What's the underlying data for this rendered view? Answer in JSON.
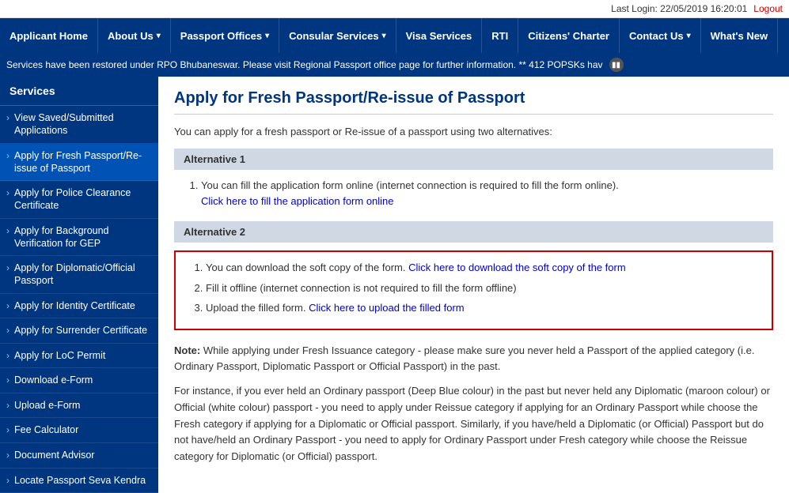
{
  "topbar": {
    "last_login_label": "Last Login: 22/05/2019 16:20:01",
    "logout_label": "Logout"
  },
  "nav": {
    "items": [
      {
        "label": "Applicant Home",
        "has_arrow": false
      },
      {
        "label": "About Us",
        "has_arrow": true
      },
      {
        "label": "Passport Offices",
        "has_arrow": true
      },
      {
        "label": "Consular Services",
        "has_arrow": true
      },
      {
        "label": "Visa Services",
        "has_arrow": false
      },
      {
        "label": "RTI",
        "has_arrow": false
      },
      {
        "label": "Citizens' Charter",
        "has_arrow": false
      },
      {
        "label": "Contact Us",
        "has_arrow": true
      },
      {
        "label": "What's New",
        "has_arrow": false
      }
    ]
  },
  "ticker": {
    "text": "Services have been restored under RPO Bhubaneswar. Please visit Regional Passport office page for further information. ** 412 POPSKs hav"
  },
  "sidebar": {
    "title": "Services",
    "items": [
      {
        "label": "View Saved/Submitted Applications"
      },
      {
        "label": "Apply for Fresh Passport/Re-issue of Passport"
      },
      {
        "label": "Apply for Police Clearance Certificate"
      },
      {
        "label": "Apply for Background Verification for GEP"
      },
      {
        "label": "Apply for Diplomatic/Official Passport"
      },
      {
        "label": "Apply for Identity Certificate"
      },
      {
        "label": "Apply for Surrender Certificate"
      },
      {
        "label": "Apply for LoC Permit"
      },
      {
        "label": "Download e-Form"
      },
      {
        "label": "Upload e-Form"
      },
      {
        "label": "Fee Calculator"
      },
      {
        "label": "Document Advisor"
      },
      {
        "label": "Locate Passport Seva Kendra"
      }
    ]
  },
  "main": {
    "page_title": "Apply for Fresh Passport/Re-issue of Passport",
    "intro": "You can apply for a fresh passport or Re-issue of a passport using two alternatives:",
    "alt1": {
      "header": "Alternative 1",
      "items": [
        {
          "text_before": "You can fill the application form online (internet connection is required to fill the form online).",
          "link_text": "Click here to fill the application form online",
          "link_href": "#"
        }
      ]
    },
    "alt2": {
      "header": "Alternative 2",
      "items": [
        {
          "text_before": "You can download the soft copy of the form.",
          "link_text": "Click here to download the soft copy of the form",
          "link_href": "#"
        },
        {
          "text_only": "Fill it offline (internet connection is not required to fill the form offline)"
        },
        {
          "text_before": "Upload the filled form.",
          "link_text": "Click here to upload the filled form",
          "link_href": "#"
        }
      ]
    },
    "note": {
      "label": "Note:",
      "para1": "While applying under Fresh Issuance category - please make sure you never held a Passport of the applied category (i.e. Ordinary Passport, Diplomatic Passport or Official Passport) in the past.",
      "para2": "For instance, if you ever held an Ordinary passport (Deep Blue colour) in the past but never held any Diplomatic (maroon colour) or Official (white colour) passport - you need to apply under Reissue category if applying for an Ordinary Passport while choose the Fresh category if applying for a Diplomatic or Official passport. Similarly, if you have/held a Diplomatic (or Official) Passport but do not have/held an Ordinary Passport - you need to apply for Ordinary Passport under Fresh category while choose the Reissue category for Diplomatic (or Official) passport."
    }
  }
}
